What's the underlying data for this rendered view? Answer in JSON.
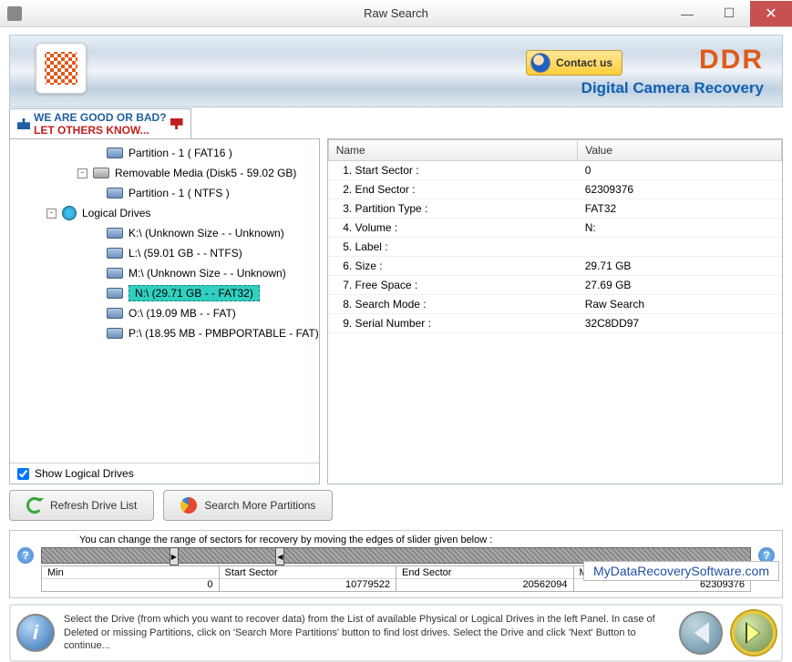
{
  "window": {
    "title": "Raw Search"
  },
  "header": {
    "contact_label": "Contact us",
    "brand": "DDR",
    "subtitle": "Digital Camera Recovery"
  },
  "feedback": {
    "line1": "WE ARE GOOD OR BAD?",
    "line2": "LET OTHERS KNOW..."
  },
  "tree": {
    "items": [
      {
        "level": "l3",
        "icon": "drive",
        "label": "Partition - 1 ( FAT16 )"
      },
      {
        "level": "l2",
        "icon": "removable",
        "expander": "-",
        "label": "Removable Media (Disk5 - 59.02 GB)"
      },
      {
        "level": "l3",
        "icon": "drive",
        "label": "Partition - 1 ( NTFS )"
      },
      {
        "level": "l1",
        "icon": "globe",
        "expander": "-",
        "label": "Logical Drives"
      },
      {
        "level": "l3",
        "icon": "drive",
        "label": "K:\\ (Unknown Size  -  - Unknown)"
      },
      {
        "level": "l3",
        "icon": "drive",
        "label": "L:\\ (59.01 GB -  - NTFS)"
      },
      {
        "level": "l3",
        "icon": "drive",
        "label": "M:\\ (Unknown Size  -  - Unknown)"
      },
      {
        "level": "l3",
        "icon": "drive",
        "label": "N:\\ (29.71 GB -  - FAT32)",
        "selected": true
      },
      {
        "level": "l3",
        "icon": "drive",
        "label": "O:\\ (19.09 MB -  - FAT)"
      },
      {
        "level": "l3",
        "icon": "drive",
        "label": "P:\\ (18.95 MB - PMBPORTABLE - FAT)"
      }
    ],
    "show_logical_label": "Show Logical Drives",
    "show_logical_checked": true
  },
  "buttons": {
    "refresh": "Refresh Drive List",
    "search_more": "Search More Partitions"
  },
  "props": {
    "col_name": "Name",
    "col_value": "Value",
    "rows": [
      {
        "name": "1. Start Sector :",
        "value": "0"
      },
      {
        "name": "2. End Sector :",
        "value": "62309376"
      },
      {
        "name": "3. Partition Type :",
        "value": "FAT32"
      },
      {
        "name": "4. Volume :",
        "value": "N:"
      },
      {
        "name": "5. Label :",
        "value": ""
      },
      {
        "name": "6. Size :",
        "value": "29.71 GB"
      },
      {
        "name": "7. Free Space :",
        "value": "27.69 GB"
      },
      {
        "name": "8. Search Mode :",
        "value": "Raw Search"
      },
      {
        "name": "9. Serial Number :",
        "value": "32C8DD97"
      }
    ]
  },
  "slider": {
    "hint": "You can change the range of sectors for recovery by moving the edges of slider given below :",
    "cells": [
      {
        "label": "Min",
        "value": "0"
      },
      {
        "label": "Start Sector",
        "value": "10779522"
      },
      {
        "label": "End Sector",
        "value": "20562094"
      },
      {
        "label": "Max",
        "value": "62309376"
      }
    ]
  },
  "info": "Select the Drive (from which you want to recover data) from the List of available Physical or Logical Drives in the left Panel. In case of Deleted or missing Partitions, click on 'Search More Partitions' button to find lost drives. Select the Drive and click 'Next' Button to continue...",
  "footer": "MyDataRecoverySoftware.com"
}
